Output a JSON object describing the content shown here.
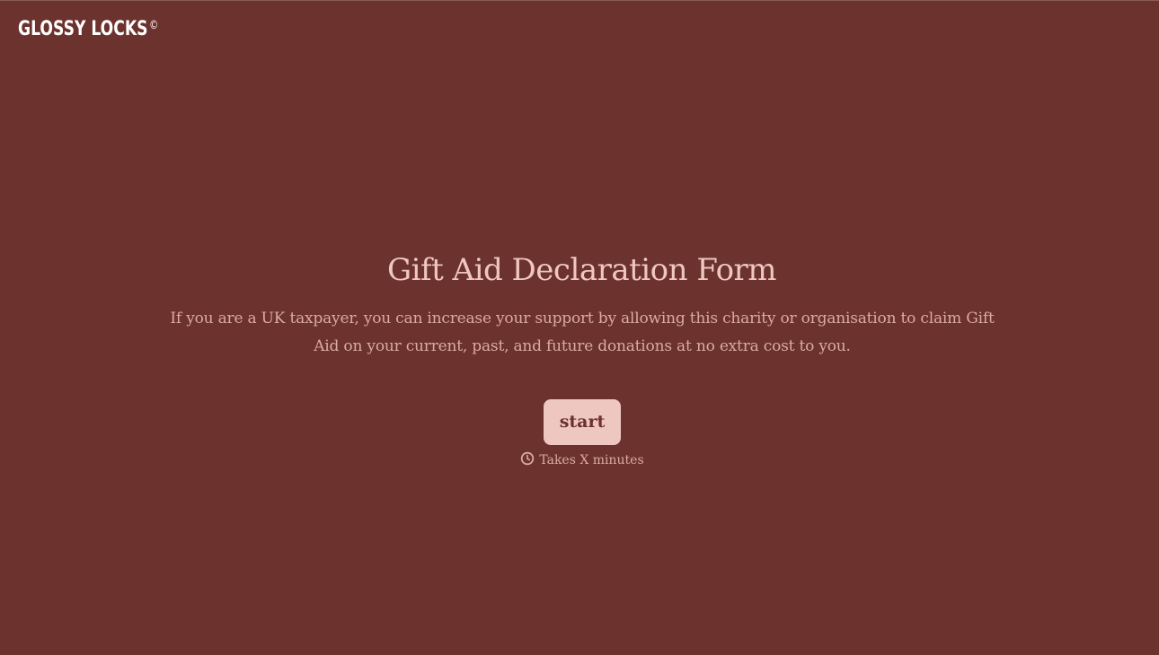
{
  "brand": {
    "name": "GLOSSY LOCKS",
    "mark": "©"
  },
  "hero": {
    "title": "Gift Aid Declaration Form",
    "description": "If you are a UK taxpayer, you can increase your support by allowing this charity or organisation to claim Gift Aid on your current, past, and future donations at no extra cost to you.",
    "start_label": "start",
    "duration_icon": "clock-icon",
    "duration_text": "Takes X minutes"
  },
  "colors": {
    "background": "#6c322d",
    "accent": "#efc7c1",
    "text_muted": "#d9aba4",
    "logo": "#ffffff"
  }
}
